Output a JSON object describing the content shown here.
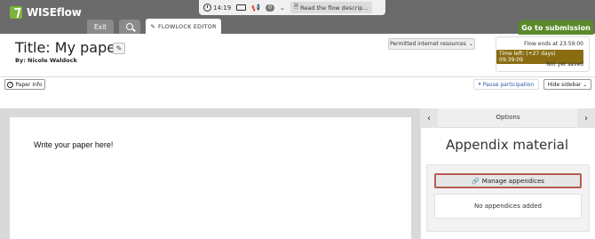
{
  "header": {
    "brand": "WISEflow",
    "timer": "14:19",
    "notifications_count": "0",
    "read_flow_label": "Read the flow descrip...",
    "exit_label": "Exit",
    "editor_tab_label": "FLOWLOCK EDITOR",
    "goto_submission_label": "Go to submission"
  },
  "paper": {
    "title": "Title: My paper",
    "byline": "By: Nicole Waldock",
    "internet_resources_label": "Permitted internet resources",
    "flow_ends": "Flow ends at 23:59:00",
    "time_left": "Time left: (+27 days) 09:39:09",
    "save_status": "Not yet saved",
    "paper_info_label": "Paper info",
    "pause_label": "Pause participation",
    "hide_sidebar_label": "Hide sidebar",
    "editor_text": "Write your paper here!"
  },
  "sidebar": {
    "options_label": "Options",
    "heading": "Appendix material",
    "manage_label": "Manage appendices",
    "empty_label": "No appendices added"
  },
  "colors": {
    "header_bg": "#6b6b6b",
    "brand_green": "#7bb53b",
    "submit_green": "#5a8a2c",
    "time_left_bg": "#8a6d12",
    "manage_border": "#b85c4f",
    "link_blue": "#2a5ba8"
  }
}
